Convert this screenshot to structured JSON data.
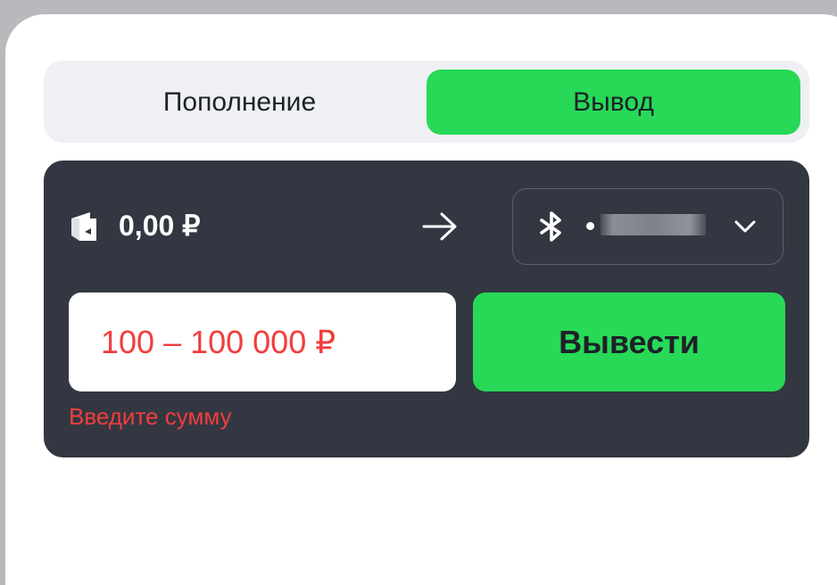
{
  "tabs": {
    "deposit_label": "Пополнение",
    "withdraw_label": "Вывод",
    "active": "withdraw"
  },
  "withdraw_card": {
    "balance": "0,00 ₽",
    "method": {
      "icon": "bluetooth-icon",
      "masked_value": "••••••",
      "masked": true
    },
    "amount": {
      "value": "",
      "placeholder": "100 – 100 000 ₽"
    },
    "submit_label": "Вывести",
    "error_message": "Введите сумму"
  },
  "colors": {
    "accent_green": "#27d957",
    "card_background": "#333741",
    "error_red": "#f23d3d",
    "tabs_background": "#eef0f4"
  }
}
